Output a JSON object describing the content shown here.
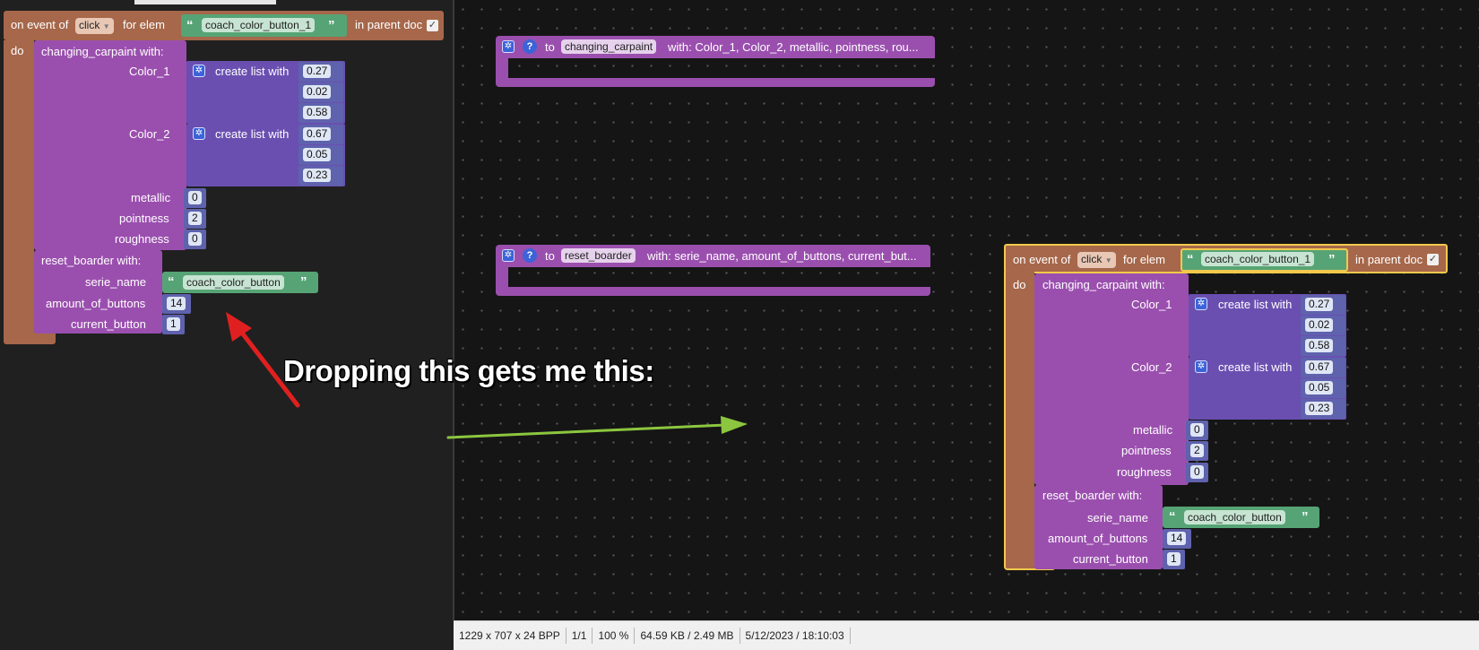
{
  "left_block": {
    "event_prefix": "on event of",
    "event_type": "click",
    "for_elem_label": "for elem",
    "elem_id": "coach_color_button_1",
    "in_parent_doc": "in parent doc",
    "do_label": "do",
    "changing_call": "changing_carpaint  with:",
    "color1_label": "Color_1",
    "color2_label": "Color_2",
    "create_list_label": "create list with",
    "color1_values": [
      "0.27",
      "0.02",
      "0.58"
    ],
    "color2_values": [
      "0.67",
      "0.05",
      "0.23"
    ],
    "metallic_label": "metallic",
    "metallic_value": "0",
    "pointness_label": "pointness",
    "pointness_value": "2",
    "roughness_label": "roughness",
    "roughness_value": "0",
    "reset_call": "reset_boarder  with:",
    "serie_name_label": "serie_name",
    "serie_name_value": "coach_color_button",
    "amount_label": "amount_of_buttons",
    "amount_value": "14",
    "current_label": "current_button",
    "current_value": "1"
  },
  "def_changing": {
    "to_label": "to",
    "name": "changing_carpaint",
    "params": "with: Color_1, Color_2, metallic, pointness, rou..."
  },
  "def_reset": {
    "to_label": "to",
    "name": "reset_boarder",
    "params": "with: serie_name, amount_of_buttons, current_but..."
  },
  "caption": "Dropping this gets me this:",
  "status_bar": {
    "dimensions": "1229 x 707 x 24 BPP",
    "page": "1/1",
    "zoom": "100 %",
    "size": "64.59 KB / 2.49 MB",
    "datetime": "5/12/2023 / 18:10:03"
  },
  "colors": {
    "event_block": "#a6674a",
    "procedure_block": "#9a4fae",
    "list_block": "#6a4fb1",
    "text_block": "#56a475",
    "arrow_red": "#e02020",
    "arrow_green": "#8cc63f"
  },
  "icons": [
    "gear-icon",
    "help-icon",
    "dropdown-icon",
    "checkbox-icon",
    "quote-icon"
  ]
}
